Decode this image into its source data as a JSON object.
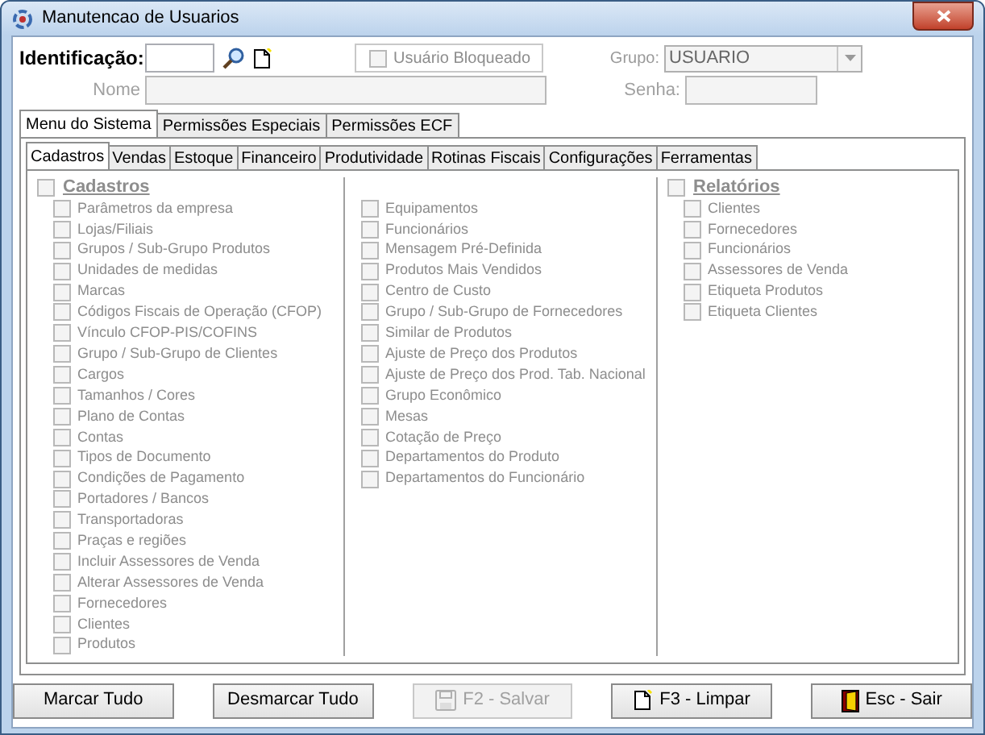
{
  "window": {
    "title": "Manutencao de Usuarios"
  },
  "form": {
    "identificacao": {
      "label": "Identificação:"
    },
    "usuario_bloqueado": {
      "label": "Usuário Bloqueado",
      "checked": false,
      "disabled": true
    },
    "grupo": {
      "label": "Grupo:",
      "value": "USUARIO",
      "disabled": true
    },
    "nome": {
      "label": "Nome",
      "disabled": true
    },
    "senha": {
      "label": "Senha:",
      "disabled": true
    }
  },
  "tabs": [
    {
      "label": "Menu do Sistema",
      "selected": true
    },
    {
      "label": "Permissões Especiais",
      "selected": false
    },
    {
      "label": "Permissões ECF",
      "selected": false
    }
  ],
  "subtabs": [
    {
      "label": "Cadastros",
      "selected": true
    },
    {
      "label": "Vendas",
      "selected": false
    },
    {
      "label": "Estoque",
      "selected": false
    },
    {
      "label": "Financeiro",
      "selected": false
    },
    {
      "label": "Produtividade",
      "selected": false
    },
    {
      "label": "Rotinas Fiscais",
      "selected": false
    },
    {
      "label": "Configurações",
      "selected": false
    },
    {
      "label": "Ferramentas",
      "selected": false
    }
  ],
  "columns": [
    {
      "header": {
        "label": "Cadastros",
        "checked": false
      },
      "items": [
        {
          "label": "Parâmetros da empresa",
          "checked": false
        },
        {
          "label": "Lojas/Filiais",
          "checked": false
        },
        {
          "label": "Grupos / Sub-Grupo Produtos",
          "checked": false
        },
        {
          "label": "Unidades de medidas",
          "checked": false
        },
        {
          "label": "Marcas",
          "checked": false
        },
        {
          "label": "Códigos Fiscais de Operação (CFOP)",
          "checked": false
        },
        {
          "label": "Vínculo CFOP-PIS/COFINS",
          "checked": false
        },
        {
          "label": "Grupo / Sub-Grupo de Clientes",
          "checked": false
        },
        {
          "label": "Cargos",
          "checked": false
        },
        {
          "label": "Tamanhos / Cores",
          "checked": false
        },
        {
          "label": "Plano de Contas",
          "checked": false
        },
        {
          "label": "Contas",
          "checked": false
        },
        {
          "label": "Tipos de Documento",
          "checked": false
        },
        {
          "label": "Condições de Pagamento",
          "checked": false
        },
        {
          "label": "Portadores / Bancos",
          "checked": false
        },
        {
          "label": "Transportadoras",
          "checked": false
        },
        {
          "label": "Praças e regiões",
          "checked": false
        },
        {
          "label": "Incluir Assessores de Venda",
          "checked": false
        },
        {
          "label": "Alterar Assessores de Venda",
          "checked": false
        },
        {
          "label": "Fornecedores",
          "checked": false
        },
        {
          "label": "Clientes",
          "checked": false
        },
        {
          "label": "Produtos",
          "checked": false
        }
      ]
    },
    {
      "items": [
        {
          "label": "Equipamentos",
          "checked": false
        },
        {
          "label": "Funcionários",
          "checked": false
        },
        {
          "label": "Mensagem Pré-Definida",
          "checked": false
        },
        {
          "label": "Produtos Mais Vendidos",
          "checked": false
        },
        {
          "label": "Centro de Custo",
          "checked": false
        },
        {
          "label": "Grupo / Sub-Grupo de Fornecedores",
          "checked": false
        },
        {
          "label": "Similar de Produtos",
          "checked": false
        },
        {
          "label": "Ajuste de Preço dos Produtos",
          "checked": false
        },
        {
          "label": "Ajuste de Preço dos Prod. Tab. Nacional",
          "checked": false
        },
        {
          "label": "Grupo Econômico",
          "checked": false
        },
        {
          "label": "Mesas",
          "checked": false
        },
        {
          "label": "Cotação de Preço",
          "checked": false
        },
        {
          "label": "Departamentos do Produto",
          "checked": false
        },
        {
          "label": "Departamentos do Funcionário",
          "checked": false
        }
      ]
    },
    {
      "header": {
        "label": "Relatórios",
        "checked": false
      },
      "items": [
        {
          "label": "Clientes",
          "checked": false
        },
        {
          "label": "Fornecedores",
          "checked": false
        },
        {
          "label": "Funcionários",
          "checked": false
        },
        {
          "label": "Assessores de Venda",
          "checked": false
        },
        {
          "label": "Etiqueta Produtos",
          "checked": false
        },
        {
          "label": "Etiqueta Clientes",
          "checked": false
        }
      ]
    }
  ],
  "disabled": true,
  "buttons": [
    {
      "label": "Marcar Tudo",
      "kind": "plain",
      "disabled": false
    },
    {
      "label": "Desmarcar Tudo",
      "kind": "plain",
      "disabled": false
    },
    {
      "label": "F2 - Salvar",
      "kind": "save",
      "disabled": true
    },
    {
      "label": "F3 - Limpar",
      "kind": "new",
      "disabled": false
    },
    {
      "label": "Esc - Sair",
      "kind": "exit",
      "disabled": false
    }
  ]
}
